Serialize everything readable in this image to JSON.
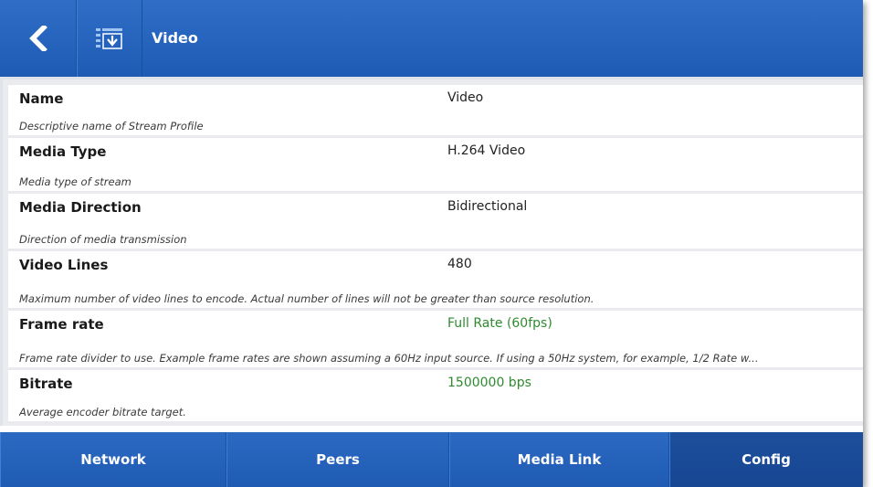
{
  "header": {
    "title": "Video",
    "back_icon": "chevron-left-icon",
    "stream_icon": "stream-profile-download-icon"
  },
  "settings": [
    {
      "name": "Name",
      "value": "Video",
      "description": "Descriptive name of Stream Profile",
      "value_color": "#222222"
    },
    {
      "name": "Media Type",
      "value": "H.264 Video",
      "description": "Media type of stream",
      "value_color": "#222222"
    },
    {
      "name": "Media Direction",
      "value": "Bidirectional",
      "description": "Direction of media transmission",
      "value_color": "#222222"
    },
    {
      "name": "Video Lines",
      "value": "480",
      "description": "Maximum number of video lines to encode. Actual number of lines will not be greater than source resolution.",
      "value_color": "#222222"
    },
    {
      "name": "Frame rate",
      "value": "Full Rate (60fps)",
      "description": "Frame rate divider to use. Example frame rates are shown assuming a 60Hz input source. If using a 50Hz system, for example, 1/2 Rate w...",
      "value_color": "#2e8b2e"
    },
    {
      "name": "Bitrate",
      "value": "1500000 bps",
      "description": "Average encoder bitrate target.",
      "value_color": "#2e8b2e"
    }
  ],
  "nav": {
    "tabs": [
      {
        "label": "Network",
        "active": false
      },
      {
        "label": "Peers",
        "active": false
      },
      {
        "label": "Media Link",
        "active": false
      },
      {
        "label": "Config",
        "active": true
      }
    ]
  },
  "colors": {
    "header_blue": "#2462bb",
    "active_tab": "#1a4b97",
    "value_green": "#2e8b2e"
  }
}
